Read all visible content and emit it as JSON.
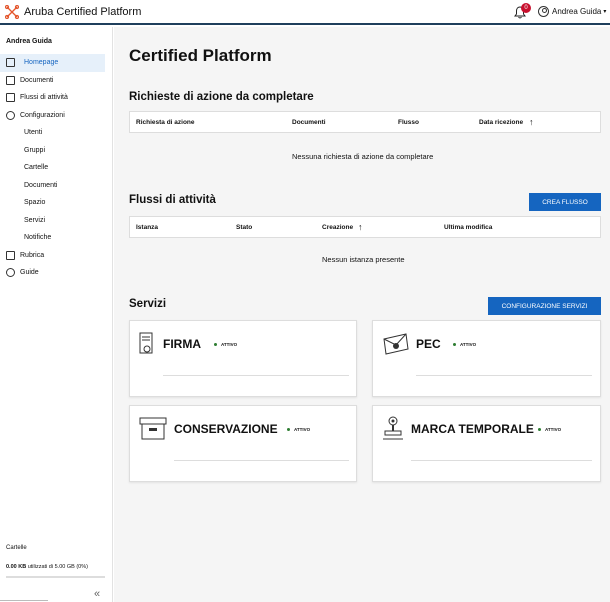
{
  "app": {
    "title": "Aruba Certified Platform"
  },
  "header": {
    "notifications_count": "0",
    "user_name": "Andrea Guida"
  },
  "sidebar": {
    "user": "Andrea Guida",
    "items": [
      {
        "label": "Homepage"
      },
      {
        "label": "Documenti"
      },
      {
        "label": "Flussi di attività"
      },
      {
        "label": "Configurazioni"
      },
      {
        "label": "Utenti"
      },
      {
        "label": "Gruppi"
      },
      {
        "label": "Cartelle"
      },
      {
        "label": "Documenti"
      },
      {
        "label": "Spazio"
      },
      {
        "label": "Servizi"
      },
      {
        "label": "Notifiche"
      },
      {
        "label": "Rubrica"
      },
      {
        "label": "Guide"
      }
    ],
    "footer_title": "Cartelle",
    "storage_used": "0.00 KB",
    "storage_text": "utilizzati di 5.00 GB (0%)",
    "storage_fraction": 0
  },
  "main": {
    "title": "Certified Platform",
    "requests": {
      "title": "Richieste di azione da completare",
      "columns": [
        "Richiesta di azione",
        "Documenti",
        "Flusso",
        "Data ricezione"
      ],
      "empty": "Nessuna richiesta di azione da completare"
    },
    "flows": {
      "title": "Flussi di attività",
      "button": "CREA FLUSSO",
      "columns": [
        "Istanza",
        "Stato",
        "Creazione",
        "Ultima modifica"
      ],
      "empty": "Nessun istanza presente"
    },
    "services": {
      "title": "Servizi",
      "button": "CONFIGURAZIONE SERVIZI",
      "cards": [
        {
          "name": "FIRMA",
          "status": "ATTIVO"
        },
        {
          "name": "PEC",
          "status": "ATTIVO"
        },
        {
          "name": "CONSERVAZIONE",
          "status": "ATTIVO"
        },
        {
          "name": "MARCA TEMPORALE",
          "status": "ATTIVO"
        }
      ]
    }
  },
  "colors": {
    "accent": "#1565c0",
    "status_active": "#2e7d32",
    "badge": "#c8102e"
  }
}
